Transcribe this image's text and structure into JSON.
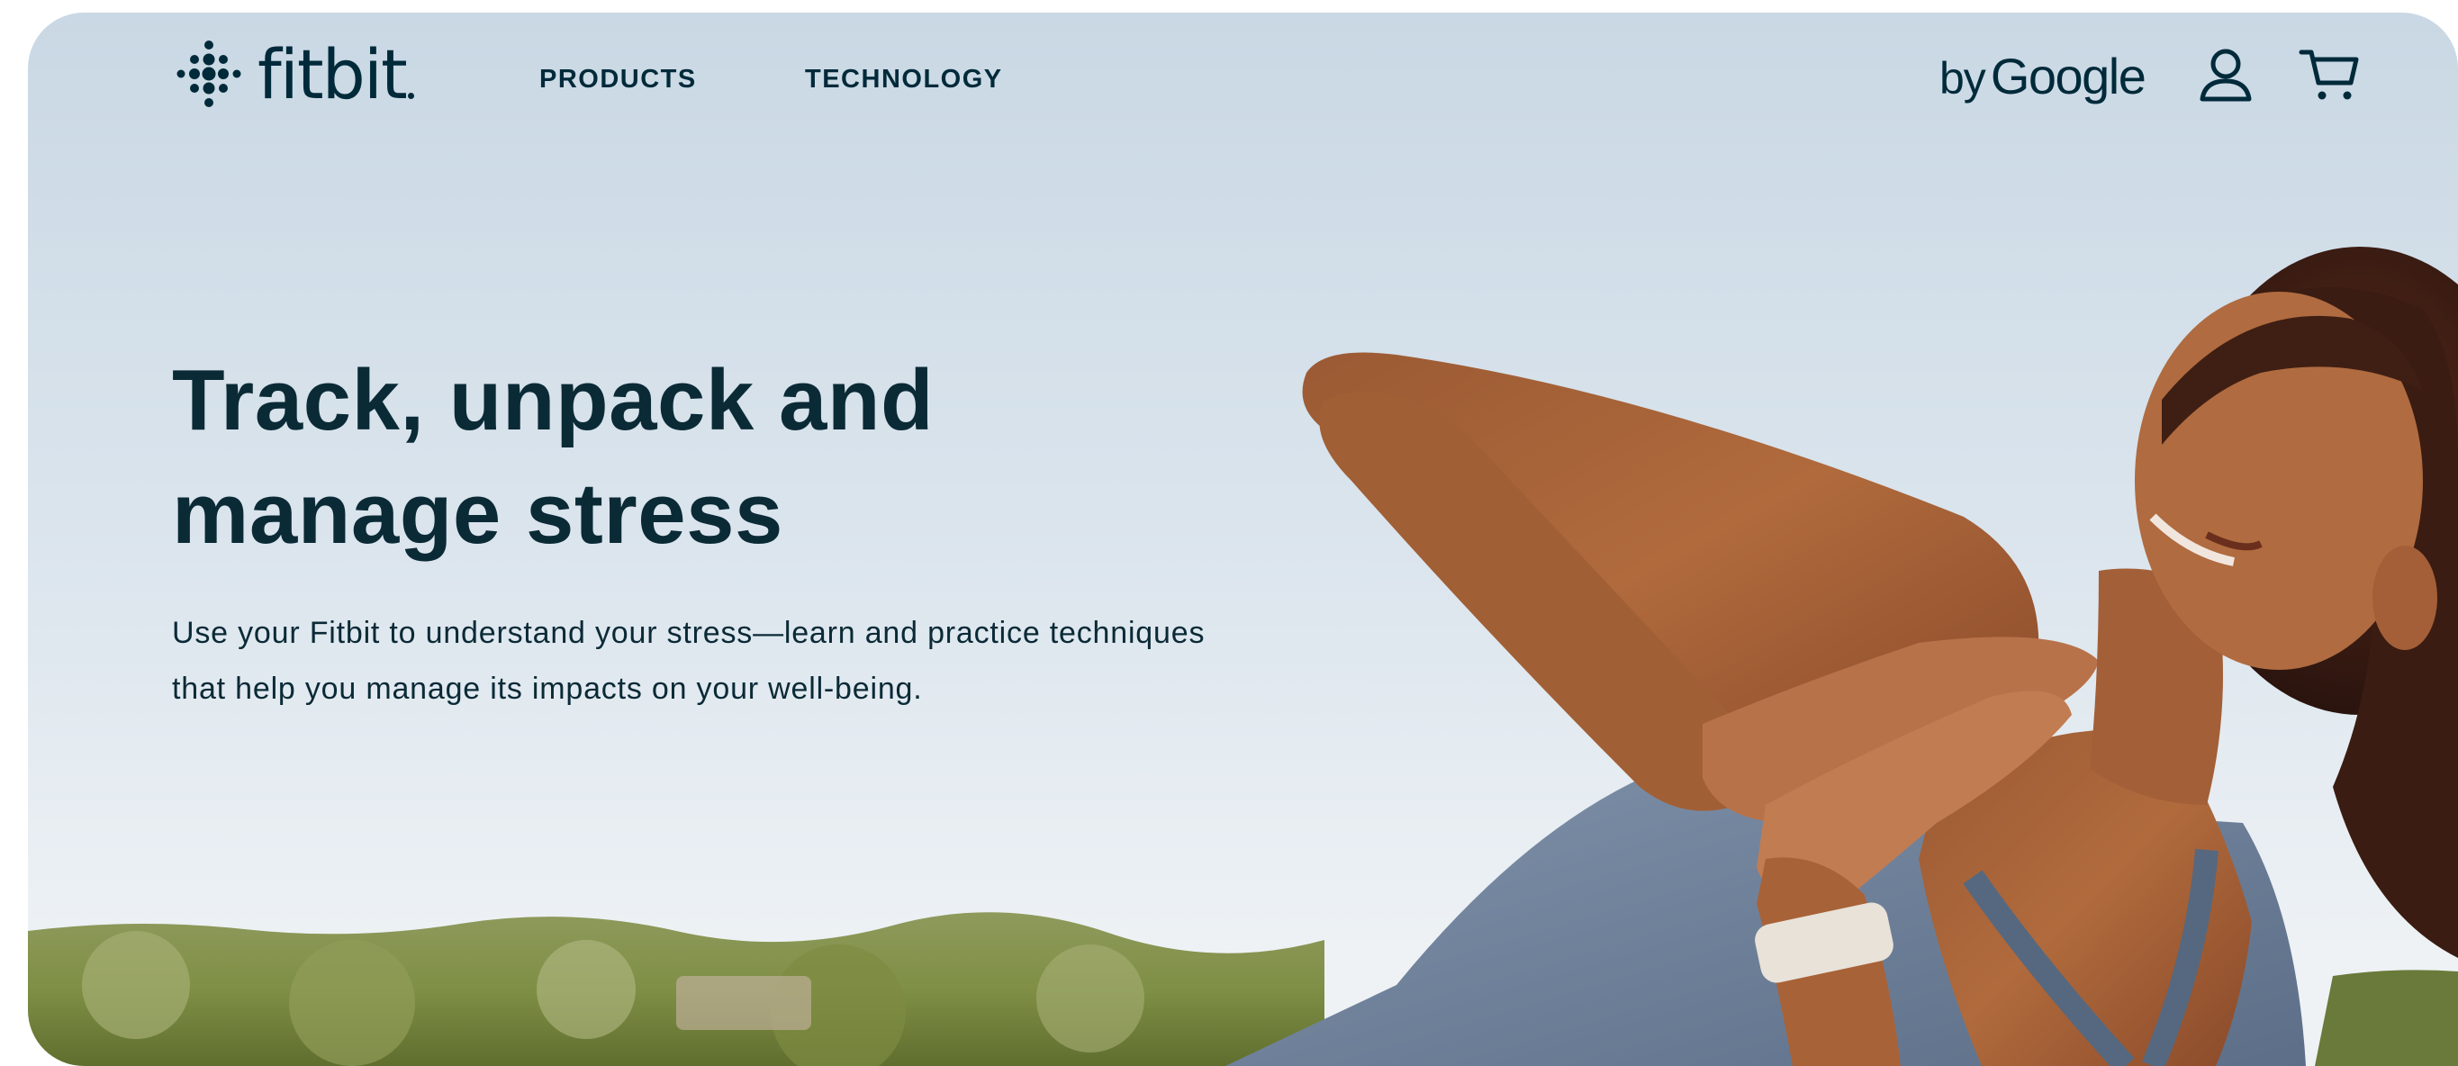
{
  "nav": {
    "logo_text": "fitbit",
    "products_label": "PRODUCTS",
    "technology_label": "TECHNOLOGY",
    "by_label": "by",
    "google_label": "Google"
  },
  "hero": {
    "title_line1": "Track, unpack and",
    "title_line2": "manage stress",
    "body": "Use your Fitbit to understand your stress—learn and practice techniques that help you manage its impacts on your well-being."
  },
  "icons": {
    "account": "account-icon",
    "cart": "cart-icon",
    "logo": "fitbit-dots-logo-icon"
  },
  "colors": {
    "text": "#002a3a",
    "sky_top": "#cddbe6",
    "sky_bottom": "#e8eef3"
  }
}
